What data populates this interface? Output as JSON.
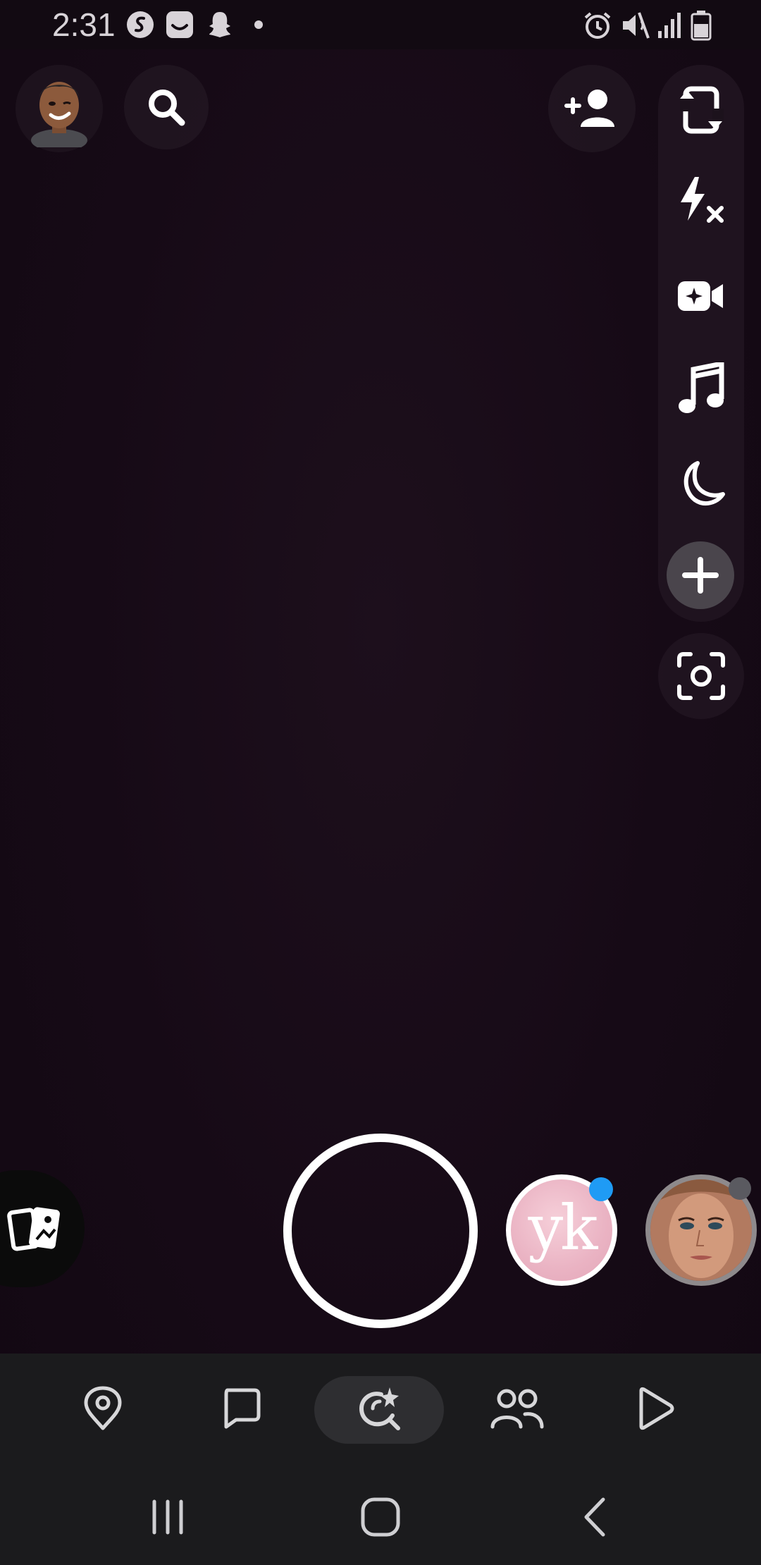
{
  "status_bar": {
    "time": "2:31",
    "left_icons": [
      "shazam-icon",
      "smile-app-icon",
      "snapchat-ghost-icon",
      "dot-icon"
    ],
    "right_icons": [
      "alarm-icon",
      "mute-icon",
      "signal-icon",
      "battery-icon"
    ]
  },
  "top_bar": {
    "avatar": "bitmoji-avatar",
    "search_icon": "search-icon",
    "add_friend_icon": "add-friend-icon"
  },
  "tool_rail": [
    "flip-camera-icon",
    "flash-off-icon",
    "video-effects-icon",
    "music-note-icon",
    "night-mode-icon",
    "plus-icon"
  ],
  "scan_icon": "scan-icon",
  "capture_row": {
    "memories_icon": "memories-icon",
    "story_1_text": "yk",
    "story_1_dot_color": "#1f9bf5",
    "story_2_dot_color": "#5a5a60"
  },
  "bottom_nav": [
    {
      "icon": "map-pin-icon",
      "active": false
    },
    {
      "icon": "chat-icon",
      "active": false
    },
    {
      "icon": "camera-lens-icon",
      "active": true
    },
    {
      "icon": "friends-icon",
      "active": false
    },
    {
      "icon": "play-icon",
      "active": false
    }
  ],
  "system_nav": [
    "recent-apps-icon",
    "home-icon",
    "back-icon"
  ],
  "colors": {
    "background": "#160a16",
    "nav_bg": "#1b1b1d",
    "accent_blue": "#1f9bf5"
  }
}
